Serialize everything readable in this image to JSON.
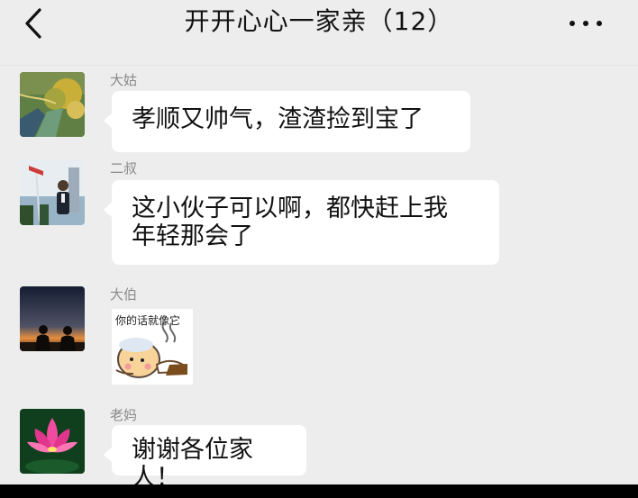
{
  "header": {
    "title": "开开心心一家亲（12）"
  },
  "messages": [
    {
      "sender": "大姑",
      "text_lines": [
        "孝顺又帅气，渣渣捡到宝了"
      ],
      "avatar": "landscape-avatar"
    },
    {
      "sender": "二叔",
      "text_lines": [
        "这小伙子可以啊，都快赶上我",
        "年轻那会了"
      ],
      "avatar": "portrait-avatar"
    },
    {
      "sender": "大伯",
      "sticker_text": "你的话就像它",
      "avatar": "sunset-avatar"
    },
    {
      "sender": "老妈",
      "text_lines": [
        "谢谢各位家人！"
      ],
      "avatar": "lotus-avatar"
    }
  ],
  "colors": {
    "background": "#ededed",
    "bubble": "#ffffff",
    "sender_text": "#8a8a8a"
  },
  "icons": {
    "back": "back-chevron-icon",
    "more": "more-options-icon"
  }
}
